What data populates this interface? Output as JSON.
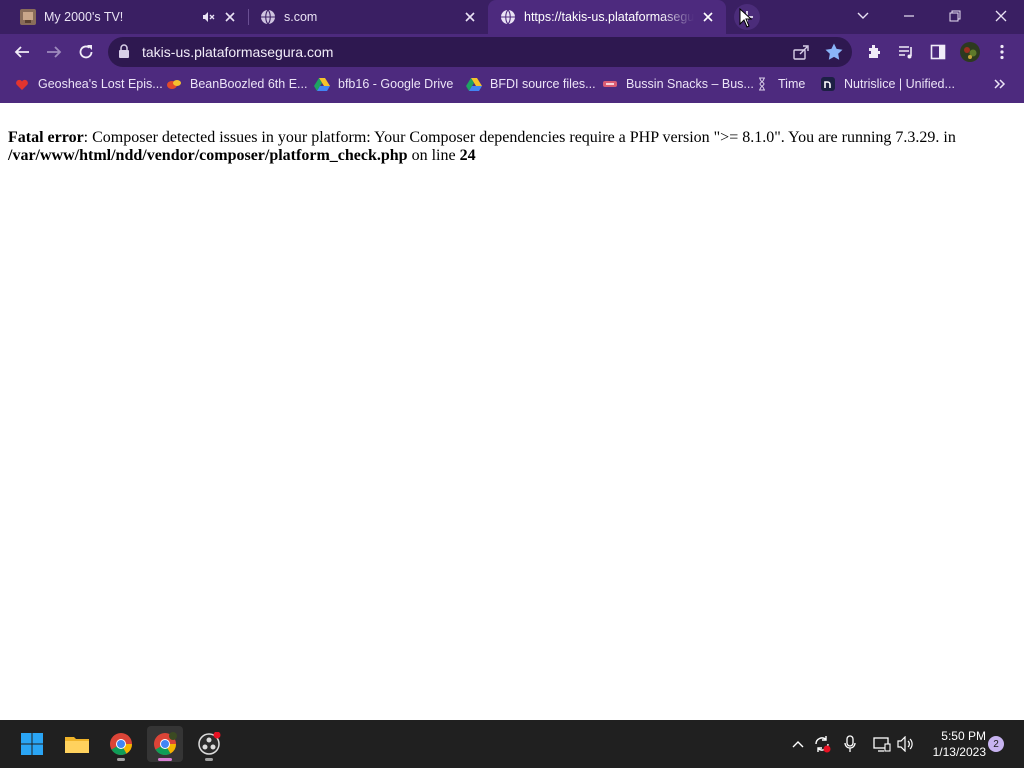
{
  "browser": {
    "tabs": [
      {
        "title": "My 2000's TV!",
        "muted": true,
        "favicon": "tv-thumbnail-icon"
      },
      {
        "title": "s.com",
        "favicon": "globe-icon"
      },
      {
        "title": "https://takis-us.plataformasegura",
        "favicon": "globe-icon",
        "active": true
      }
    ],
    "address": "takis-us.plataformasegura.com",
    "bookmarks": [
      {
        "label": "Geoshea's Lost Epis...",
        "icon": "red-heart-icon"
      },
      {
        "label": "BeanBoozled 6th E...",
        "icon": "jellybean-icon"
      },
      {
        "label": "bfb16 - Google Drive",
        "icon": "google-drive-icon"
      },
      {
        "label": "BFDI source files...",
        "icon": "google-drive-icon"
      },
      {
        "label": "Bussin Snacks – Bus...",
        "icon": "snack-icon"
      },
      {
        "label": "Time",
        "icon": "time-icon"
      },
      {
        "label": "Nutrislice | Unified...",
        "icon": "nutrislice-icon"
      }
    ],
    "colors": {
      "frame": "#3a1f63",
      "toolbar": "#4d2a7e",
      "omnibox": "#2e1850",
      "star": "#8ab4f8"
    }
  },
  "page": {
    "error_label": "Fatal error",
    "error_message": ": Composer detected issues in your platform: Your Composer dependencies require a PHP version \">= 8.1.0\". You are running 7.3.29. in",
    "error_path": "/var/www/html/ndd/vendor/composer/platform_check.php",
    "on_line": " on line ",
    "line_number": "24"
  },
  "taskbar": {
    "apps": [
      "windows-start-icon",
      "file-explorer-icon",
      "chrome-icon",
      "chrome-profile-icon",
      "obs-icon"
    ],
    "time": "5:50 PM",
    "date": "1/13/2023",
    "notifications": "2"
  }
}
